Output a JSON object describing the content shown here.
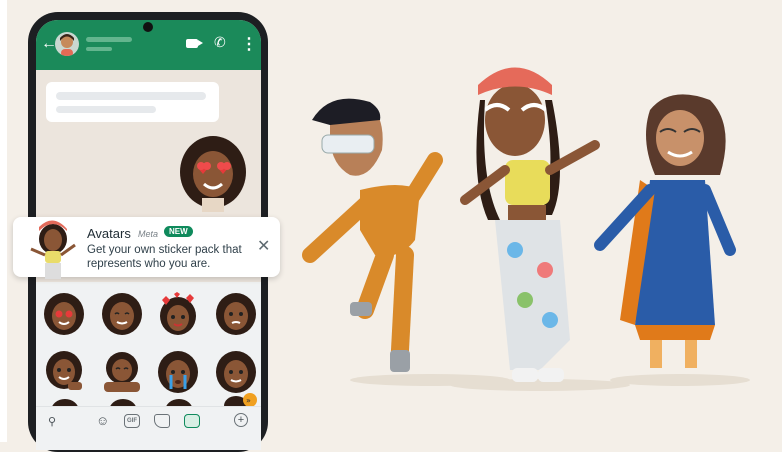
{
  "notification": {
    "title": "Avatars",
    "meta": "Meta",
    "badge": "NEW",
    "body": "Get your own sticker pack that represents who you are."
  },
  "tray": {
    "gif_label": "GIF"
  },
  "icons": {
    "back": "arrow-left-icon",
    "video": "video-icon",
    "call": "phone-icon",
    "more": "more-vertical-icon",
    "close": "close-icon",
    "search": "search-icon",
    "emoji": "emoji-icon",
    "sticker": "sticker-icon",
    "avatar": "avatar-icon",
    "add": "plus-icon"
  },
  "colors": {
    "header": "#1b8a5a",
    "badge": "#0f8a5c",
    "background": "#f4efe8"
  }
}
